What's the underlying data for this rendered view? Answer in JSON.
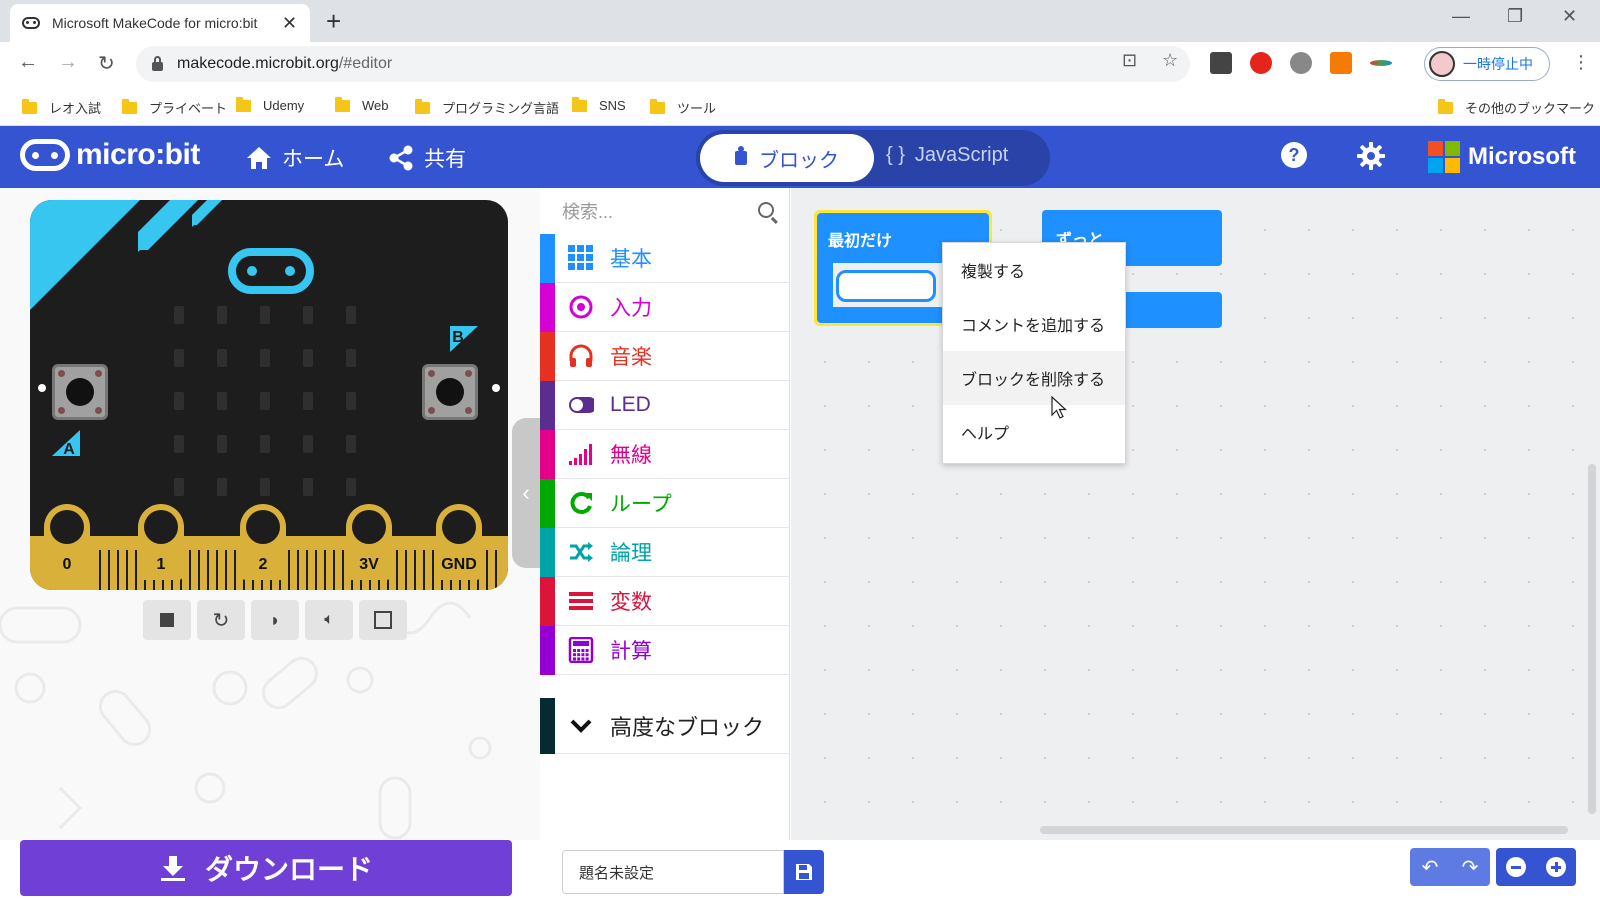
{
  "browser": {
    "tab_title": "Microsoft MakeCode for micro:bit",
    "tab_close": "✕",
    "new_tab": "+",
    "url_host": "makecode.microbit.org",
    "url_path": "/#editor",
    "profile_label": "一時停止中",
    "bookmarks": [
      "レオ入試",
      "プライベート",
      "Udemy",
      "Web",
      "プログラミング言語",
      "SNS",
      "ツール"
    ],
    "other_bookmarks": "その他のブックマーク"
  },
  "header": {
    "logo": "micro:bit",
    "home": "ホーム",
    "share": "共有",
    "mode_blocks": "ブロック",
    "mode_js": "JavaScript",
    "microsoft": "Microsoft"
  },
  "simulator": {
    "pins": [
      "0",
      "1",
      "2",
      "3V",
      "GND"
    ],
    "button_a": "A",
    "button_b": "B"
  },
  "toolbox": {
    "search_placeholder": "検索...",
    "categories": [
      {
        "label": "基本",
        "color": "#1e90ff",
        "icon": "grid-icon"
      },
      {
        "label": "入力",
        "color": "#d400d4",
        "icon": "target-icon"
      },
      {
        "label": "音楽",
        "color": "#e63022",
        "icon": "headphones-icon"
      },
      {
        "label": "LED",
        "color": "#5c2d91",
        "icon": "toggle-icon"
      },
      {
        "label": "無線",
        "color": "#e3008c",
        "icon": "signal-bars-icon"
      },
      {
        "label": "ループ",
        "color": "#00aa00",
        "icon": "refresh-icon"
      },
      {
        "label": "論理",
        "color": "#00a4a6",
        "icon": "shuffle-icon"
      },
      {
        "label": "変数",
        "color": "#dc143c",
        "icon": "list-lines-icon"
      },
      {
        "label": "計算",
        "color": "#9400d3",
        "icon": "calculator-icon"
      }
    ],
    "advanced": "高度なブロック"
  },
  "workspace": {
    "block_on_start": "最初だけ",
    "block_forever": "ずっと"
  },
  "context_menu": {
    "items": [
      "複製する",
      "コメントを追加する",
      "ブロックを削除する",
      "ヘルプ"
    ]
  },
  "bottom": {
    "download": "ダウンロード",
    "project_name": "題名未設定"
  }
}
